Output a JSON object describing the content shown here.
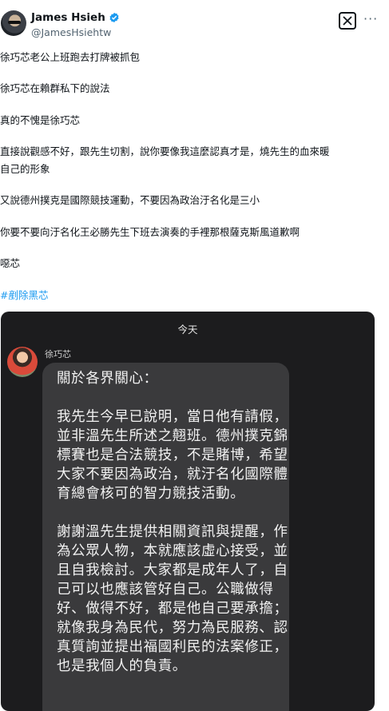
{
  "author": {
    "display_name": "James Hsieh",
    "handle": "@JamesHsiehtw",
    "verified": true,
    "verified_color": "#1d9bf0"
  },
  "actions": {
    "grok_icon": "grok-icon",
    "more_label": "···"
  },
  "post": {
    "lines": [
      "徐巧芯老公上班跑去打牌被抓包",
      "徐巧芯在賴群私下的說法",
      "真的不愧是徐巧芯",
      "直接說觀感不好，跟先生切割，說你要像我這麼認真才是，燒先生的血來暖",
      "自己的形象",
      "又說德州撲克是國際競技運動，不要因為政治汙名化是三小",
      "你要不要向汙名化王必勝先生下班去演奏的手裡那根薩克斯風道歉啊",
      "噁芯"
    ],
    "hashtag": "#剷除黑芯",
    "hashtag_color": "#1d9bf0"
  },
  "chat": {
    "date": "今天",
    "sender": "徐巧芯",
    "message": "關於各界關心：\n\n我先生今早已說明，當日他有請假，並非溫先生所述之翹班。德州撲克錦標賽也是合法競技，不是賭博，希望大家不要因為政治，就汙名化國際體育總會核可的智力競技活動。\n\n謝謝溫先生提供相關資訊與提醒，作為公眾人物，本就應該虛心接受，並且自我檢討。大家都是成年人了，自己可以也應該管好自己。公職做得好、做得不好，都是他自己要承擔；就像我身為民代，努力為民服務、認真質詢並提出福國利民的法案修正，也是我個人的負責。"
  }
}
